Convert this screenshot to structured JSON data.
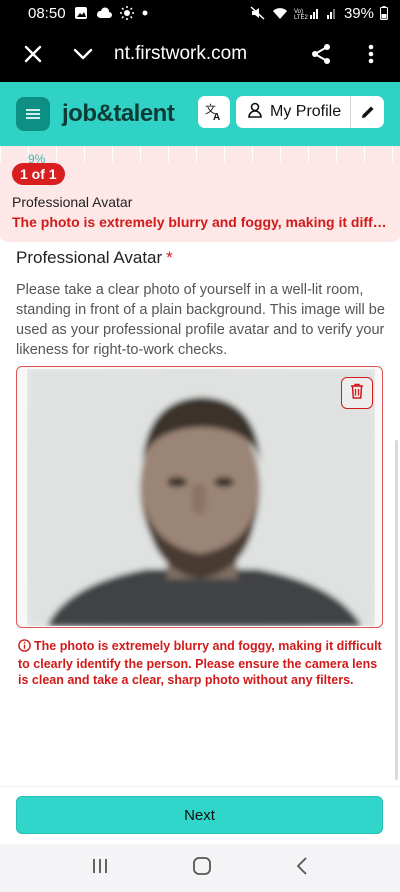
{
  "status_bar": {
    "time": "08:50",
    "battery": "39%",
    "network": "Vo)\nLTE2"
  },
  "browser": {
    "url": "nt.firstwork.com"
  },
  "header": {
    "logo": "job&talent",
    "profile_label": "My Profile"
  },
  "banner": {
    "progress": "9%",
    "count": "1 of 1",
    "title": "Professional Avatar",
    "error": "The photo is extremely blurry and foggy, making it diffic..."
  },
  "field": {
    "label": "Professional Avatar",
    "required_mark": "*",
    "description": "Please take a clear photo of yourself in a well-lit room, standing in front of a plain background. This image will be used as your professional profile avatar and to verify your likeness for right-to-work checks.",
    "error": "The photo is extremely blurry and foggy, making it difficult to clearly identify the person. Please ensure the camera lens is clean and take a clear, sharp photo without any filters."
  },
  "footer": {
    "next_label": "Next"
  },
  "colors": {
    "brand": "#31d2c6",
    "error": "#d11a1a",
    "button": "#2fd6c9"
  }
}
